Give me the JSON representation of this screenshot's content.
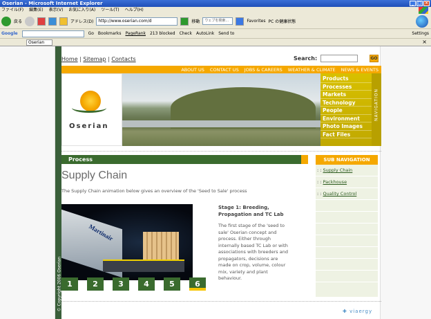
{
  "browser": {
    "title": "Oserian - Microsoft Internet Explorer",
    "menu": [
      "ファイル(F)",
      "編集(E)",
      "表示(V)",
      "お気に入り(A)",
      "ツール(T)",
      "ヘルプ(H)"
    ],
    "back_label": "戻る",
    "address_label": "アドレス(D)",
    "address_value": "http://www.oserian.com/d",
    "go_label": "移動",
    "search_placeholder": "ウェブを検索...",
    "favorites_label": "Favorites",
    "pc_label": "PC の健康状態",
    "google_label": "Google",
    "go_small": "Go",
    "bookmarks_label": "Bookmarks",
    "pagerank_label": "PageRank",
    "blocked_label": "213 blocked",
    "check_label": "Check",
    "autolink_label": "AutoLink",
    "sendto_label": "Send to",
    "settings_label": "Settings",
    "tab_label": "Oserian"
  },
  "site": {
    "toplinks": [
      "Home",
      "Sitemap",
      "Contacts"
    ],
    "search_label": "Search:",
    "go_button": "GO",
    "nav": [
      "ABOUT US",
      "CONTACT US",
      "JOBS & CAREERS",
      "WEATHER & CLIMATE",
      "NEWS & EVENTS"
    ],
    "logo_text": "Oserian",
    "menu": [
      "Products",
      "Processes",
      "Markets",
      "Technology",
      "People",
      "Environment",
      "Photo Images",
      "Fact Files"
    ],
    "navigation_label": "NAVIGATION",
    "section_label": "Process",
    "heading": "Supply Chain",
    "intro": "The Supply Chain animation below gives an overview of the 'Seed to Sale' process",
    "stage_title": "Stage 1: Breeding, Propagation and TC Lab",
    "stage_desc": "The first stage of the 'seed to sale' Oserian concept and process. Either through internally based TC Lab or with associations with breeders and propagators, decisions are made on crop, volume, colour mix, variety and plant behaviour.",
    "stages": [
      "1",
      "2",
      "3",
      "4",
      "5",
      "6"
    ],
    "active_stage": 6,
    "plane_text": "Martinair",
    "subnav_head": "SUB NAVIGATION",
    "subnav": [
      "Supply Chain",
      "Packhouse",
      "Quality Control"
    ],
    "copyright": "© Copyright 2006 Oserian",
    "credit": "viaergy"
  },
  "colors": {
    "orange": "#f5a800",
    "green": "#3a6b2e",
    "mustard": "#c8b400"
  }
}
